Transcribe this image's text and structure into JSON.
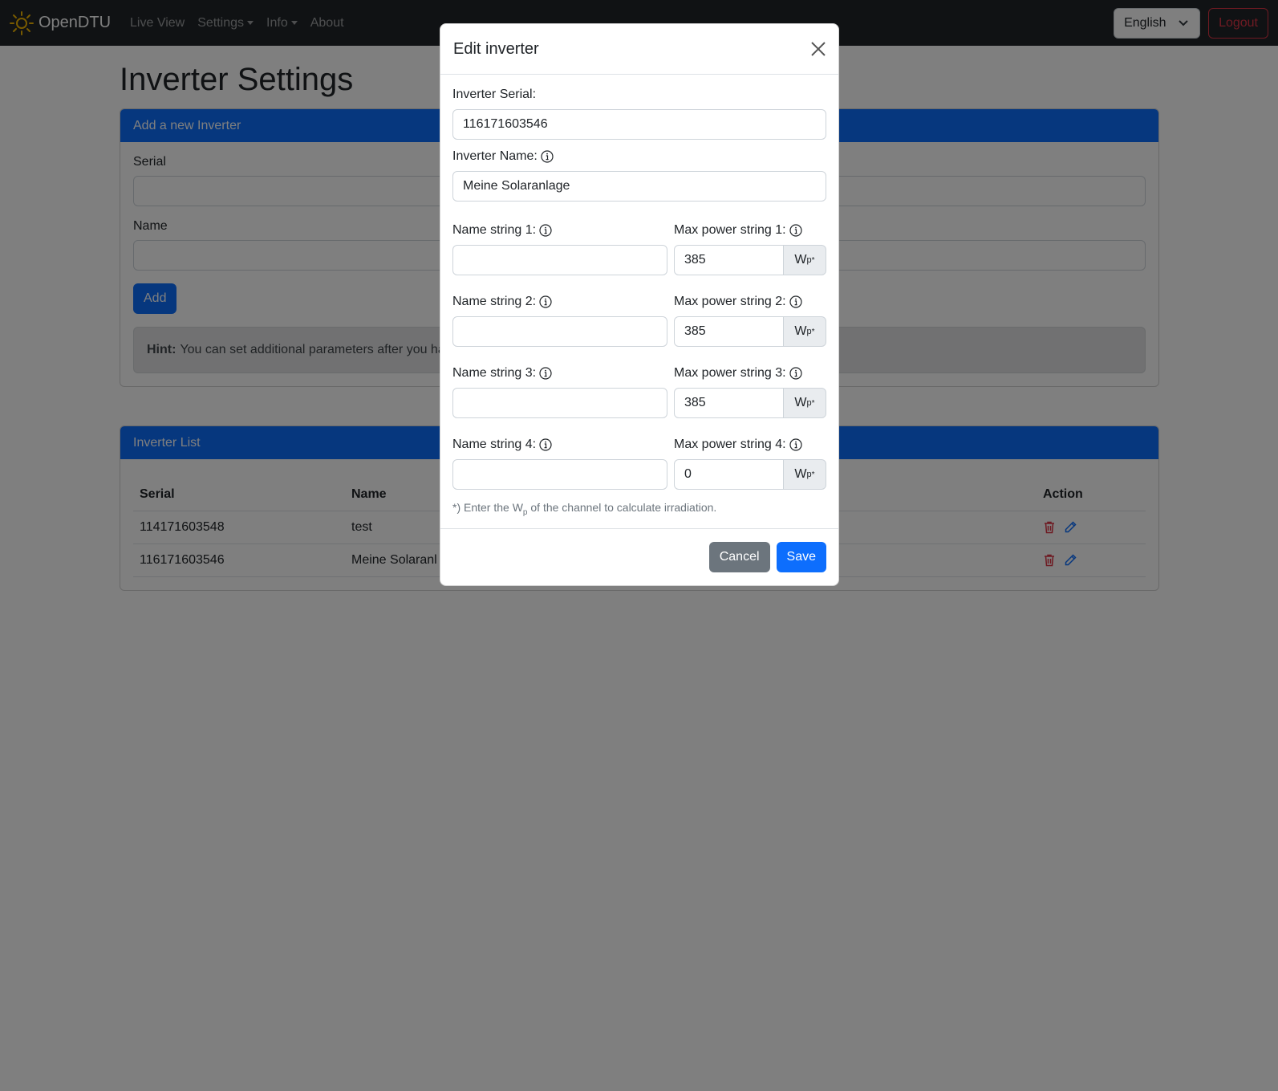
{
  "navbar": {
    "brand": "OpenDTU",
    "links": [
      {
        "label": "Live View",
        "dropdown": false
      },
      {
        "label": "Settings",
        "dropdown": true
      },
      {
        "label": "Info",
        "dropdown": true
      },
      {
        "label": "About",
        "dropdown": false
      }
    ],
    "language": "English",
    "logout": "Logout"
  },
  "page": {
    "title": "Inverter Settings"
  },
  "add_card": {
    "header": "Add a new Inverter",
    "serial_label": "Serial",
    "name_label": "Name",
    "add_button": "Add",
    "hint_bold": "Hint:",
    "hint_text": "You can set additional parameters after you ha"
  },
  "list_card": {
    "header": "Inverter List",
    "columns": [
      "Serial",
      "Name",
      "Action"
    ],
    "rows": [
      {
        "serial": "114171603548",
        "name": "test"
      },
      {
        "serial": "116171603546",
        "name": "Meine Solaranl"
      }
    ]
  },
  "modal": {
    "title": "Edit inverter",
    "serial_label": "Inverter Serial:",
    "serial_value": "116171603546",
    "name_label": "Inverter Name:",
    "name_value": "Meine Solaranlage",
    "strings": [
      {
        "name_label": "Name string 1:",
        "name_value": "",
        "power_label": "Max power string 1:",
        "power_value": "385"
      },
      {
        "name_label": "Name string 2:",
        "name_value": "",
        "power_label": "Max power string 2:",
        "power_value": "385"
      },
      {
        "name_label": "Name string 3:",
        "name_value": "",
        "power_label": "Max power string 3:",
        "power_value": "385"
      },
      {
        "name_label": "Name string 4:",
        "name_value": "",
        "power_label": "Max power string 4:",
        "power_value": "0"
      }
    ],
    "unit_main": "W",
    "unit_sub": "p",
    "unit_sup": "*",
    "note_prefix": "*) Enter the W",
    "note_sub": "p",
    "note_suffix": "of the channel to calculate irradiation.",
    "cancel": "Cancel",
    "save": "Save"
  },
  "colors": {
    "primary": "#0d6efd",
    "danger": "#dc3545",
    "navbar": "#212529",
    "brand_icon": "#f0b400"
  }
}
